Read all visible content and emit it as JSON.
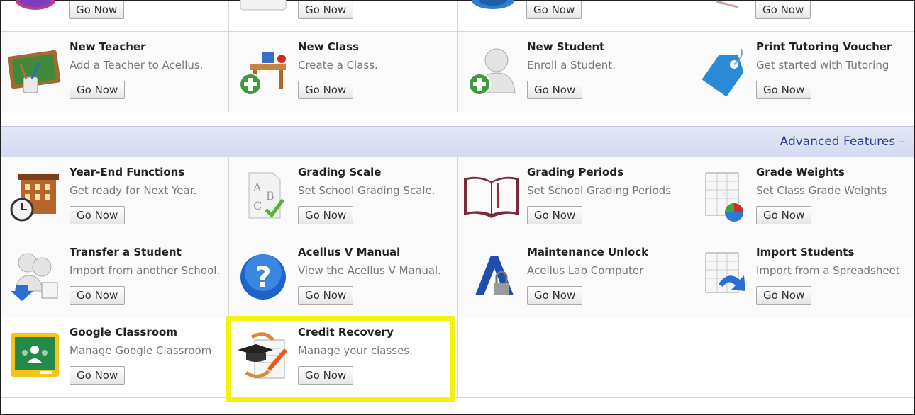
{
  "top_row": {
    "buttons": [
      "Go Now",
      "Go Now",
      "Go Now",
      "Go Now"
    ]
  },
  "row1": [
    {
      "title": "New Teacher",
      "desc": "Add a Teacher to Acellus.",
      "button": "Go Now",
      "icon": "chalkboard-icon"
    },
    {
      "title": "New Class",
      "desc": "Create a Class.",
      "button": "Go Now",
      "icon": "desk-add-icon"
    },
    {
      "title": "New Student",
      "desc": "Enroll a Student.",
      "button": "Go Now",
      "icon": "user-add-icon"
    },
    {
      "title": "Print Tutoring Voucher",
      "desc": "Get started with Tutoring",
      "button": "Go Now",
      "icon": "tag-icon"
    }
  ],
  "advanced": {
    "label": "Advanced Features –"
  },
  "row2": [
    {
      "title": "Year-End Functions",
      "desc": "Get ready for Next Year.",
      "button": "Go Now",
      "icon": "school-clock-icon"
    },
    {
      "title": "Grading Scale",
      "desc": "Set School Grading Scale.",
      "button": "Go Now",
      "icon": "abc-checkmark-icon"
    },
    {
      "title": "Grading Periods",
      "desc": "Set School Grading Periods",
      "button": "Go Now",
      "icon": "open-book-icon"
    },
    {
      "title": "Grade Weights",
      "desc": "Set Class Grade Weights",
      "button": "Go Now",
      "icon": "spreadsheet-pie-icon"
    }
  ],
  "row3": [
    {
      "title": "Transfer a Student",
      "desc": "Import from another School.",
      "button": "Go Now",
      "icon": "users-transfer-icon"
    },
    {
      "title": "Acellus V Manual",
      "desc": "View the Acellus V Manual.",
      "button": "Go Now",
      "icon": "help-question-icon"
    },
    {
      "title": "Maintenance Unlock",
      "desc": "Acellus Lab Computer",
      "button": "Go Now",
      "icon": "acellus-lock-icon"
    },
    {
      "title": "Import Students",
      "desc": "Import from a Spreadsheet",
      "button": "Go Now",
      "icon": "spreadsheet-import-icon"
    }
  ],
  "row4": [
    {
      "title": "Google Classroom",
      "desc": "Manage Google Classroom",
      "button": "Go Now",
      "icon": "google-classroom-icon"
    },
    {
      "title": "Credit Recovery",
      "desc": "Manage your classes.",
      "button": "Go Now",
      "icon": "graduation-pencil-icon"
    }
  ],
  "colors": {
    "accent": "#2b3f8f",
    "highlight": "#f4f20a",
    "section_bar": "#d8deef"
  }
}
